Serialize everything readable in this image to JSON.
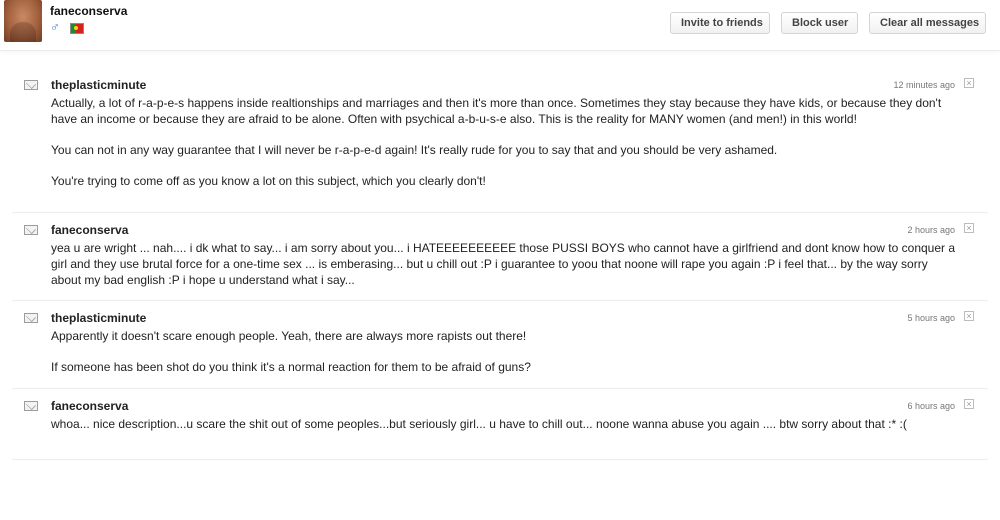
{
  "profile": {
    "username": "faneconserva",
    "gender_icon": "♂",
    "flag": "portugal-flag-icon"
  },
  "toolbar": {
    "invite_label": "Invite to friends",
    "block_label": "Block user",
    "clear_label": "Clear all messages"
  },
  "messages": [
    {
      "sender": "theplasticminute",
      "time": "12 minutes ago",
      "paragraphs": [
        "Actually, a lot of r-a-p-e-s happens inside realtionships and marriages and then it's more than once. Sometimes they stay because they have kids, or because they don't have an income or because they are afraid to be alone. Often with psychical a-b-u-s-e also. This is the reality for MANY women (and men!) in this world!",
        "You can not in any way guarantee that I will never be r-a-p-e-d again! It's really rude for you to say that and you should be very ashamed.",
        "You're trying to come off as you know a lot on this subject, which you clearly don't!"
      ]
    },
    {
      "sender": "faneconserva",
      "time": "2 hours ago",
      "paragraphs": [
        "yea u are wright ... nah.... i dk what to say... i am sorry about you... i HATEEEEEEEEEE those PUSSI BOYS who cannot have a girlfriend and dont know how to conquer a girl and they use brutal force for a one-time sex ... is emberasing... but u chill out :P i guarantee to yoou that noone will rape you again :P i feel that... by the way sorry about my bad english :P i hope u understand what i say..."
      ]
    },
    {
      "sender": "theplasticminute",
      "time": "5 hours ago",
      "paragraphs": [
        "Apparently it doesn't scare enough people. Yeah, there are always more rapists out there!",
        "If someone has been shot do you think it's a normal reaction for them to be afraid of guns?"
      ]
    },
    {
      "sender": "faneconserva",
      "time": "6 hours ago",
      "paragraphs": [
        "whoa... nice description...u scare the shit out of some peoples...but seriously girl... u have to chill out... noone wanna abuse you again .... btw sorry about that :* :("
      ]
    }
  ],
  "icons": {
    "message": "mail-icon",
    "delete": "close-icon",
    "close_glyph": "×"
  }
}
